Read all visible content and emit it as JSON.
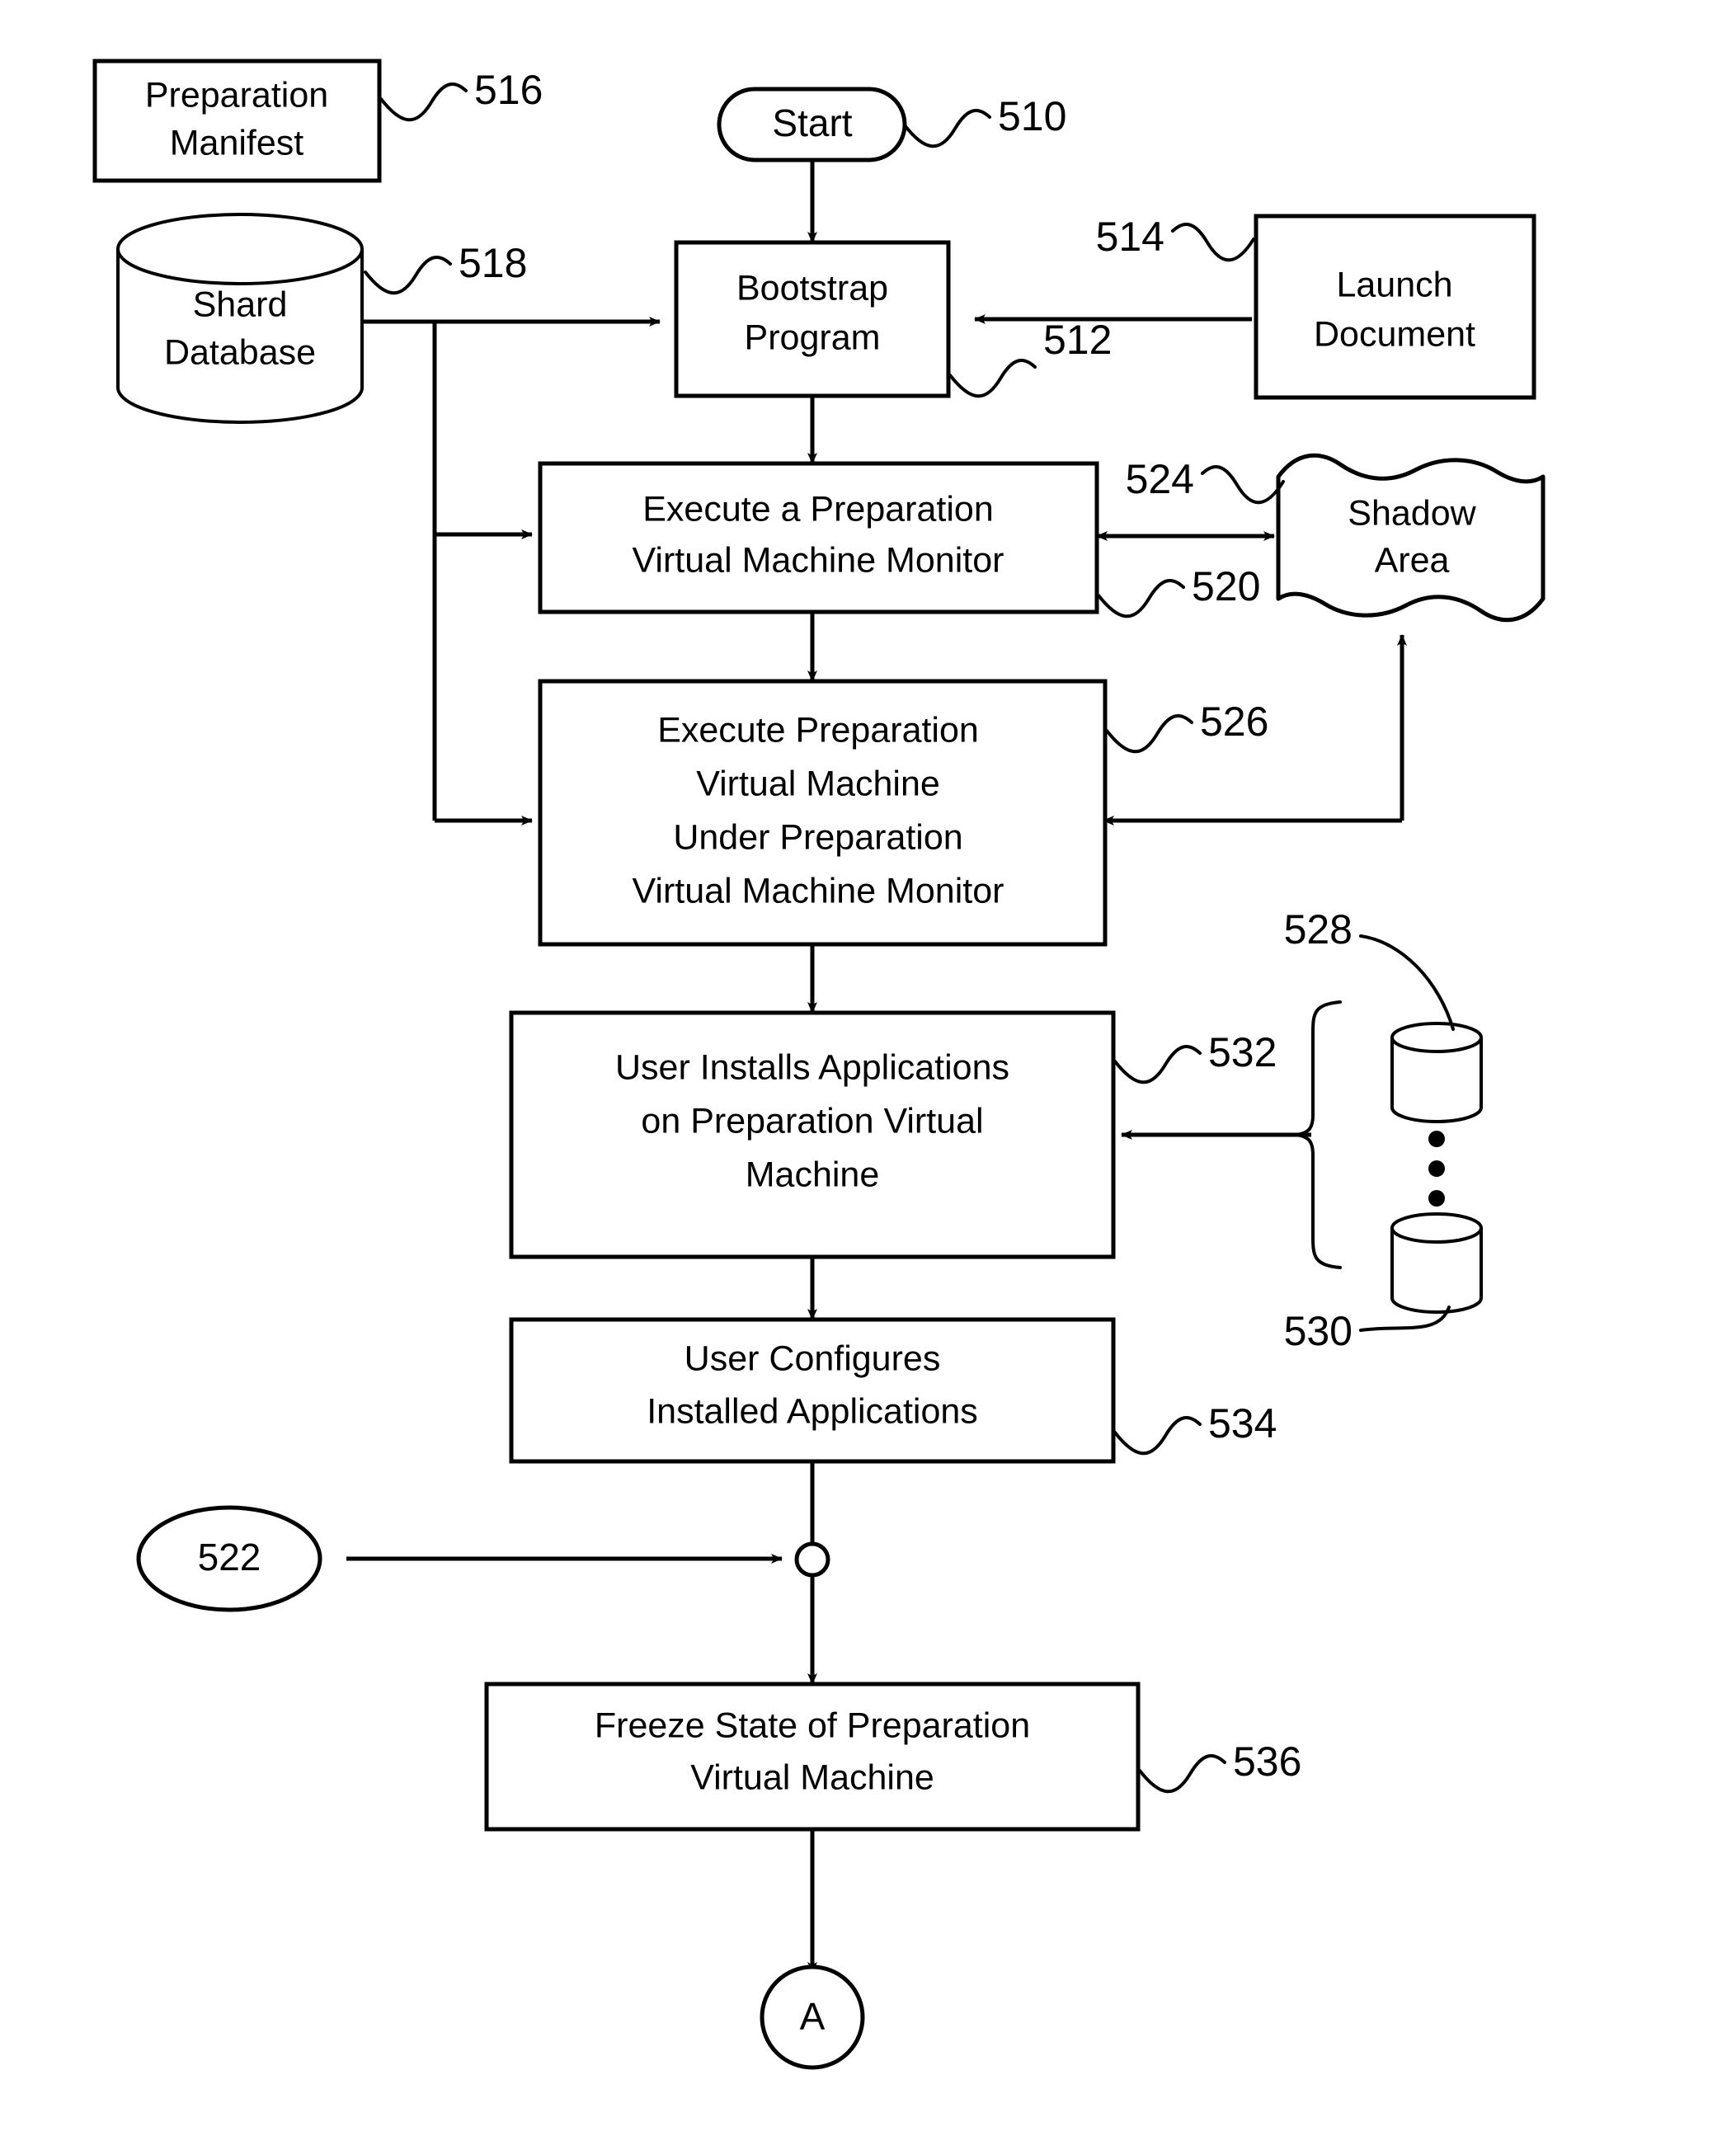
{
  "figure": {
    "type": "patent-flowchart",
    "orientation": "vertical"
  },
  "nodes": {
    "start": {
      "label": "Start",
      "ref": "510",
      "shape": "stadium"
    },
    "bootstrap": {
      "line1": "Bootstrap",
      "line2": "Program",
      "ref": "512",
      "shape": "rect"
    },
    "launch_document": {
      "line1": "Launch",
      "line2": "Document",
      "ref": "514",
      "shape": "rect"
    },
    "preparation_manifest": {
      "line1": "Preparation",
      "line2": "Manifest",
      "ref": "516",
      "shape": "rect"
    },
    "shard_database": {
      "line1": "Shard",
      "line2": "Database",
      "ref": "518",
      "shape": "cylinder"
    },
    "execute_vmm": {
      "line1": "Execute a Preparation",
      "line2": "Virtual Machine Monitor",
      "ref": "520",
      "shape": "rect"
    },
    "shadow_area": {
      "line1": "Shadow",
      "line2": "Area",
      "ref": "524",
      "shape": "wavy"
    },
    "execute_vm": {
      "line1": "Execute Preparation",
      "line2": "Virtual Machine",
      "line3": "Under Preparation",
      "line4": "Virtual Machine Monitor",
      "ref": "526",
      "shape": "rect"
    },
    "user_installs": {
      "line1": "User Installs Applications",
      "line2": "on Preparation Virtual",
      "line3": "Machine",
      "ref": "532",
      "shape": "rect"
    },
    "app_source_top": {
      "ref": "528",
      "shape": "cylinder"
    },
    "app_source_bottom": {
      "ref": "530",
      "shape": "cylinder"
    },
    "user_configures": {
      "line1": "User Configures",
      "line2": "Installed Applications",
      "ref": "534",
      "shape": "rect"
    },
    "offpage_in": {
      "label": "522",
      "shape": "ellipse"
    },
    "freeze_state": {
      "line1": "Freeze State of Preparation",
      "line2": "Virtual Machine",
      "ref": "536",
      "shape": "rect"
    },
    "offpage_out": {
      "label": "A",
      "shape": "circle"
    }
  },
  "refs": {
    "r510": "510",
    "r512": "512",
    "r514": "514",
    "r516": "516",
    "r518": "518",
    "r520": "520",
    "r522": "522",
    "r524": "524",
    "r526": "526",
    "r528": "528",
    "r530": "530",
    "r532": "532",
    "r534": "534",
    "r536": "536"
  },
  "colors": {
    "stroke": "#000000",
    "fill": "#ffffff",
    "background": "#ffffff"
  }
}
